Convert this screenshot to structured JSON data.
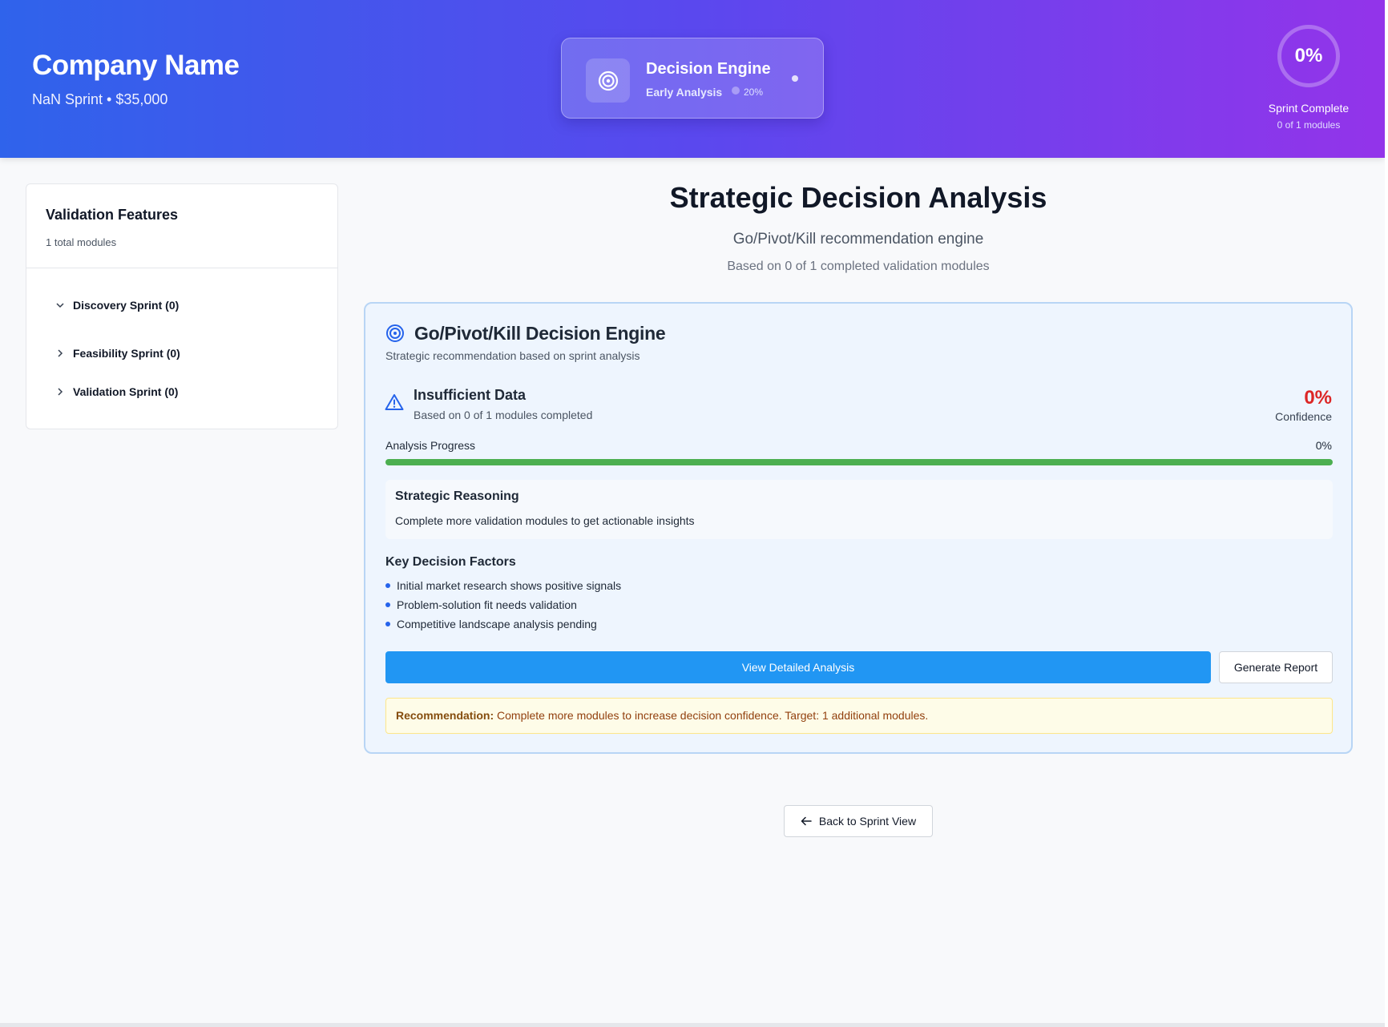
{
  "header": {
    "company_name": "Company Name",
    "company_sub": "NaN Sprint • $35,000",
    "engine": {
      "title": "Decision Engine",
      "phase": "Early Analysis",
      "percent": "20%",
      "icon": "target-icon"
    },
    "sprint_progress": {
      "value": "0%",
      "label": "Sprint Complete",
      "sub": "0 of 1 modules"
    }
  },
  "sidebar": {
    "title": "Validation Features",
    "count": "1 total modules",
    "items": [
      {
        "label": "Discovery Sprint (0)",
        "expanded": true
      },
      {
        "label": "Feasibility Sprint (0)",
        "expanded": false
      },
      {
        "label": "Validation Sprint (0)",
        "expanded": false
      }
    ]
  },
  "main": {
    "title": "Strategic Decision Analysis",
    "subtitle": "Go/Pivot/Kill recommendation engine",
    "based_on": "Based on 0 of 1 completed validation modules"
  },
  "panel": {
    "title": "Go/Pivot/Kill Decision Engine",
    "subtitle": "Strategic recommendation based on sprint analysis",
    "status_title": "Insufficient Data",
    "status_sub": "Based on 0 of 1 modules completed",
    "confidence_value": "0%",
    "confidence_label": "Confidence",
    "progress_label": "Analysis Progress",
    "progress_pct": "0%",
    "reasoning_title": "Strategic Reasoning",
    "reasoning_text": "Complete more validation modules to get actionable insights",
    "factors_title": "Key Decision Factors",
    "factors": [
      "Initial market research shows positive signals",
      "Problem-solution fit needs validation",
      "Competitive landscape analysis pending"
    ],
    "primary_button": "View Detailed Analysis",
    "secondary_button": "Generate Report",
    "recommendation_label": "Recommendation:",
    "recommendation_text": " Complete more modules to increase decision confidence. Target: 1 additional modules."
  },
  "back_button": "Back to Sprint View",
  "colors": {
    "header_start": "#2f63eb",
    "header_end": "#9334ea",
    "accent_blue": "#2196f3",
    "confidence_red": "#dc2626",
    "progress_green": "#4caf50"
  }
}
